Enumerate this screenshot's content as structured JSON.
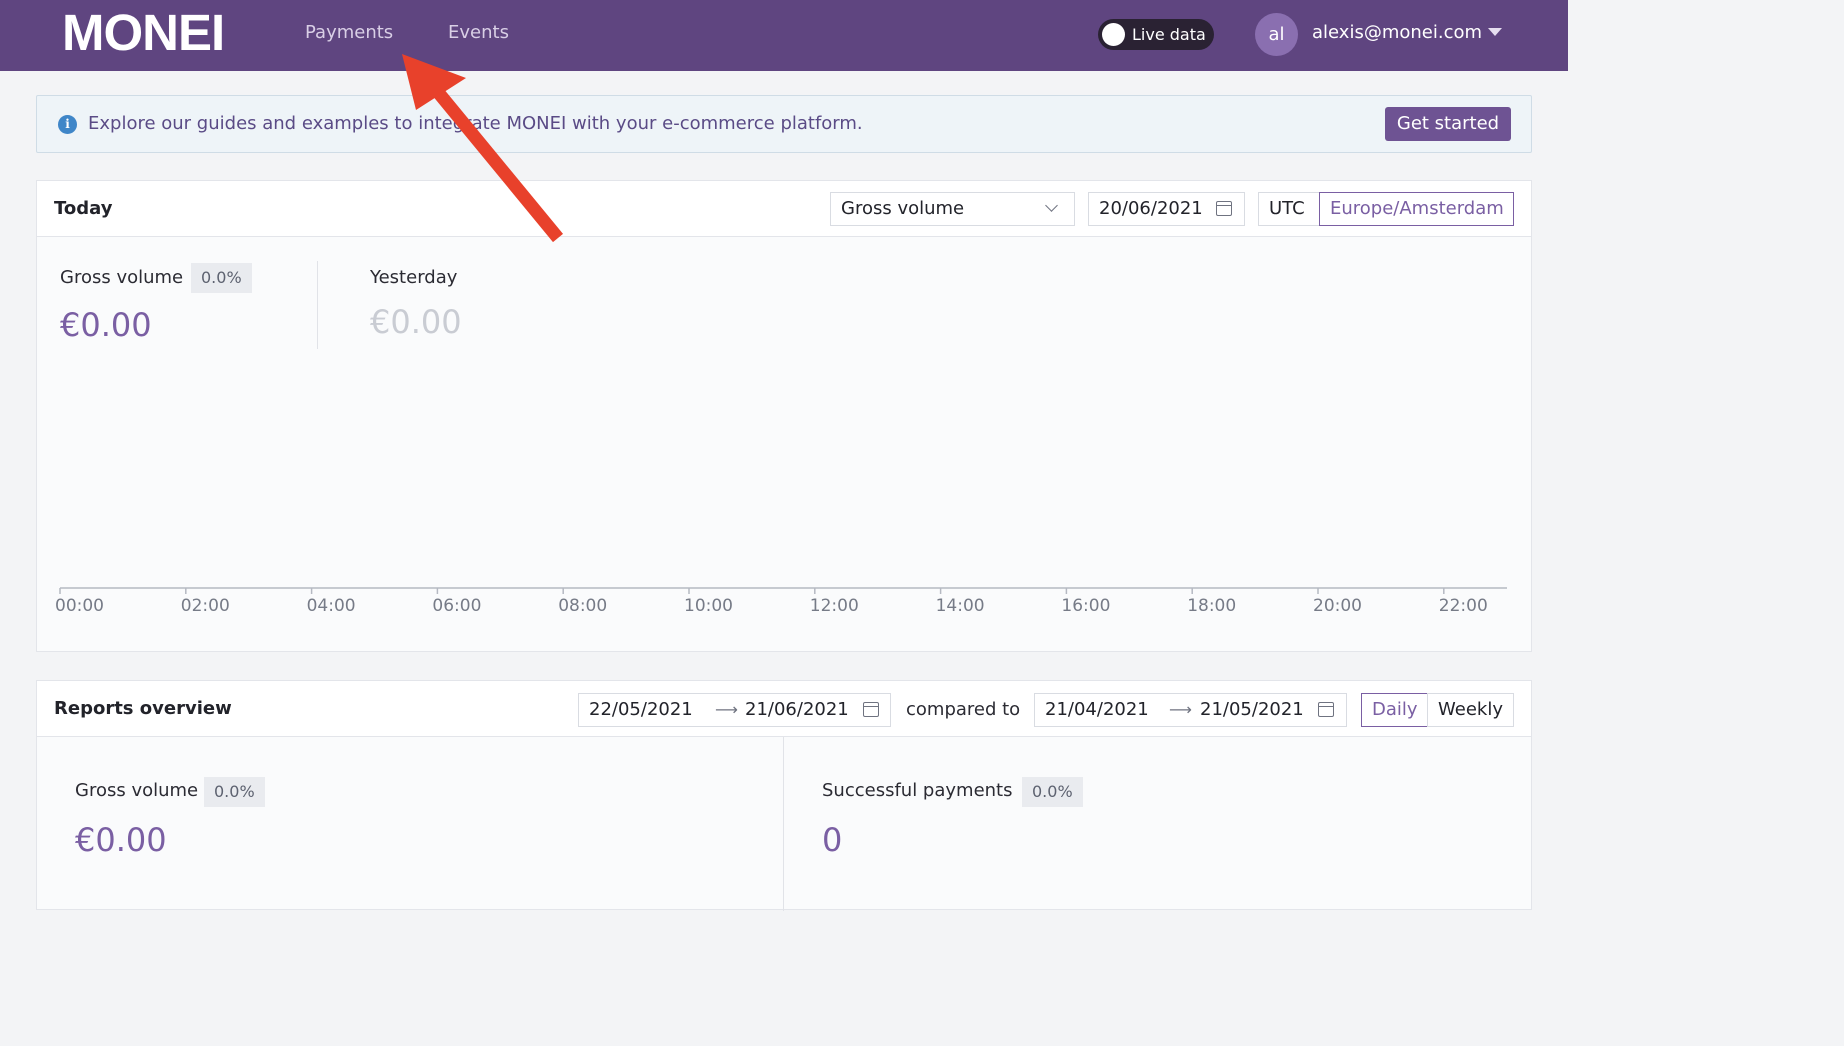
{
  "header": {
    "logo": "MONEI",
    "nav": [
      "Payments",
      "Events"
    ],
    "live_toggle_label": "Live data",
    "avatar_initials": "al",
    "user_email": "alexis@monei.com"
  },
  "banner": {
    "text": "Explore our guides and examples to integrate MONEI with your e-commerce platform.",
    "button": "Get started"
  },
  "today": {
    "title": "Today",
    "metric_select": "Gross volume",
    "date": "20/06/2021",
    "tz_options": [
      "UTC",
      "Europe/Amsterdam"
    ],
    "tz_selected": "Europe/Amsterdam",
    "current": {
      "label": "Gross volume",
      "change": "0.0%",
      "amount": "€0.00"
    },
    "previous": {
      "label": "Yesterday",
      "amount": "€0.00"
    },
    "hour_ticks": [
      "00:00",
      "02:00",
      "04:00",
      "06:00",
      "08:00",
      "10:00",
      "12:00",
      "14:00",
      "16:00",
      "18:00",
      "20:00",
      "22:00"
    ]
  },
  "reports": {
    "title": "Reports overview",
    "range_start": "22/05/2021",
    "range_end": "21/06/2021",
    "compared_label": "compared to",
    "compare_start": "21/04/2021",
    "compare_end": "21/05/2021",
    "granularity": [
      "Daily",
      "Weekly"
    ],
    "granularity_selected": "Daily",
    "gross": {
      "label": "Gross volume",
      "change": "0.0%",
      "amount": "€0.00"
    },
    "payments": {
      "label": "Successful payments",
      "change": "0.0%",
      "count": "0"
    }
  },
  "colors": {
    "brand": "#5f4580",
    "accent": "#7a5fa3",
    "annotation_arrow": "#e8412b"
  }
}
